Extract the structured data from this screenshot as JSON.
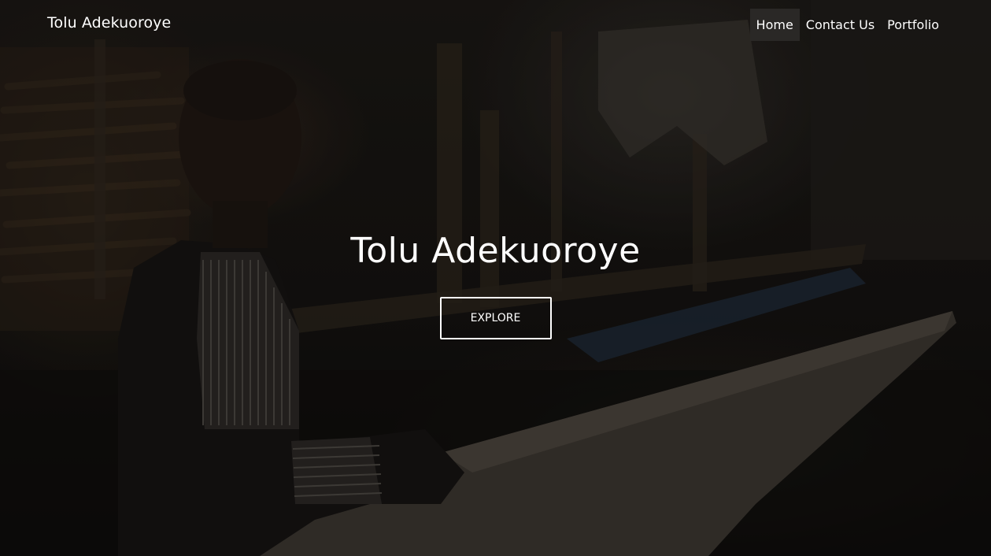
{
  "navbar": {
    "brand": "Tolu Adekuoroye",
    "links": [
      {
        "label": "Home",
        "active": true
      },
      {
        "label": "Contact Us",
        "active": false
      },
      {
        "label": "Portfolio",
        "active": false
      }
    ]
  },
  "hero": {
    "title": "Tolu Adekuoroye",
    "button_label": "EXPLORE",
    "background_image": "dark-photo-boy-in-canoe"
  },
  "colors": {
    "text": "#ffffff",
    "active_nav_bg": "#2a2826",
    "overlay": "#000000"
  }
}
